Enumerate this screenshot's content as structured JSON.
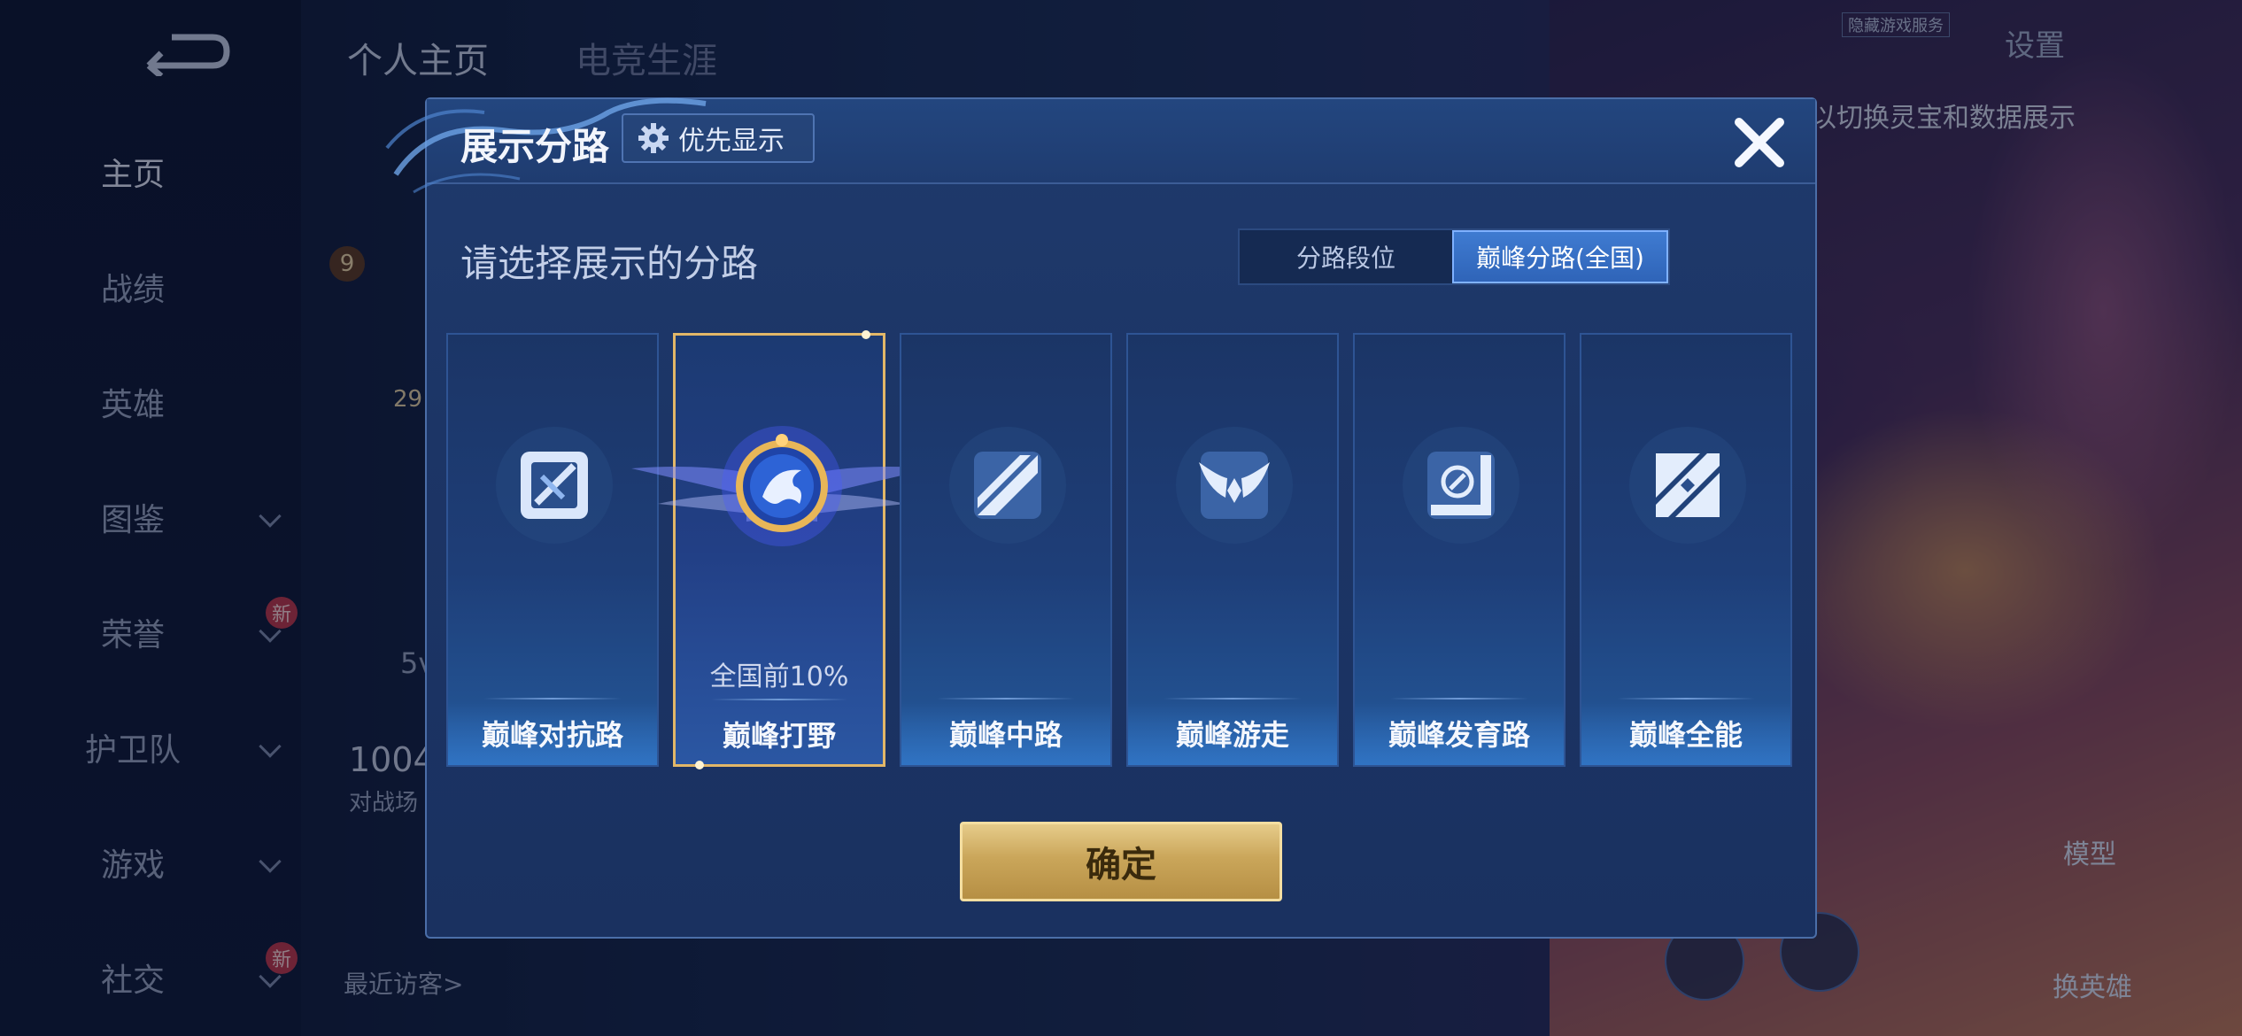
{
  "background": {
    "top_tabs": [
      "个人主页",
      "电竞生涯"
    ],
    "sidebar_items": [
      {
        "label": "主页",
        "active": true,
        "chevron": false,
        "new": false
      },
      {
        "label": "战绩",
        "active": false,
        "chevron": false,
        "new": false
      },
      {
        "label": "英雄",
        "active": false,
        "chevron": false,
        "new": false
      },
      {
        "label": "图鉴",
        "active": false,
        "chevron": true,
        "new": false
      },
      {
        "label": "荣誉",
        "active": false,
        "chevron": true,
        "new": true
      },
      {
        "label": "护卫队",
        "active": false,
        "chevron": true,
        "new": false
      },
      {
        "label": "游戏",
        "active": false,
        "chevron": true,
        "new": false
      },
      {
        "label": "社交",
        "active": false,
        "chevron": true,
        "new": true
      }
    ],
    "new_badge": "新",
    "level_badge": "9",
    "level_number": "29",
    "stat_value": "1004",
    "stat_label": "对战场",
    "side_stat": "5v",
    "recent_visitors": "最近访客>",
    "settings_label": "设置",
    "hint_text": "以切换灵宝和数据展示",
    "small_tag": "隐藏游戏服务",
    "right_buttons": [
      "模型",
      "换英雄"
    ]
  },
  "dialog": {
    "title": "展示分路",
    "priority_button": "优先显示",
    "subtitle": "请选择展示的分路",
    "segments": [
      {
        "label": "分路段位",
        "active": false
      },
      {
        "label": "巅峰分路(全国)",
        "active": true
      }
    ],
    "cards": [
      {
        "name": "巅峰对抗路",
        "icon": "sword-lane-icon",
        "selected": false,
        "rank": ""
      },
      {
        "name": "巅峰打野",
        "icon": "dragon-jungle-emblem-icon",
        "selected": true,
        "rank": "全国前10%"
      },
      {
        "name": "巅峰中路",
        "icon": "mid-lane-icon",
        "selected": false,
        "rank": ""
      },
      {
        "name": "巅峰游走",
        "icon": "wings-roam-icon",
        "selected": false,
        "rank": ""
      },
      {
        "name": "巅峰发育路",
        "icon": "target-farm-icon",
        "selected": false,
        "rank": ""
      },
      {
        "name": "巅峰全能",
        "icon": "all-round-icon",
        "selected": false,
        "rank": ""
      }
    ],
    "confirm_button": "确定"
  },
  "colors": {
    "accent_gold": "#e2b768",
    "segment_active": "#3a74c8",
    "dialog_bg": "#1c3566"
  }
}
